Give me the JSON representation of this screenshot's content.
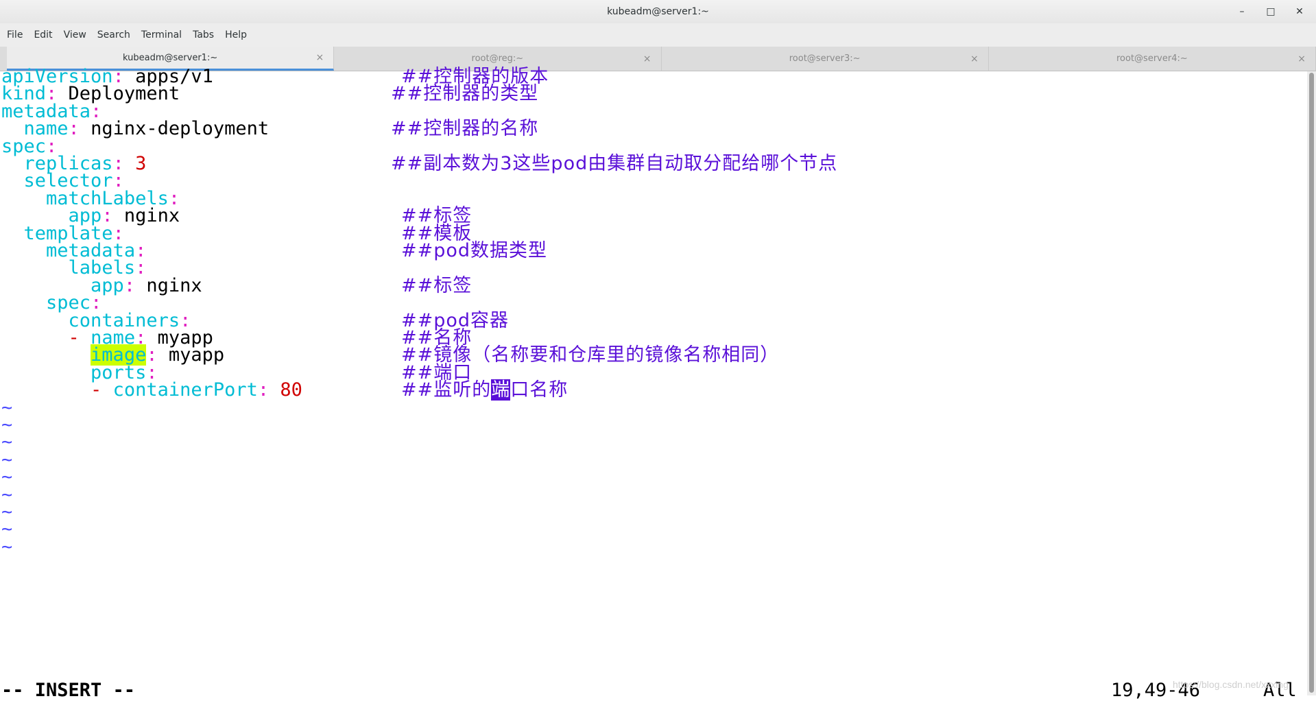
{
  "window": {
    "title": "kubeadm@server1:~",
    "minimize_icon": "minimize-icon",
    "maximize_icon": "maximize-icon",
    "close_icon": "close-icon"
  },
  "menu": [
    "File",
    "Edit",
    "View",
    "Search",
    "Terminal",
    "Tabs",
    "Help"
  ],
  "tabs": [
    {
      "label": "kubeadm@server1:~",
      "active": true
    },
    {
      "label": "root@reg:~",
      "active": false
    },
    {
      "label": "root@server3:~",
      "active": false
    },
    {
      "label": "root@server4:~",
      "active": false
    }
  ],
  "tab_close_glyph": "×",
  "editor": {
    "lines": [
      {
        "indent": "",
        "key": "apiVersion",
        "sep": ": ",
        "val": "apps/v1",
        "comment": "##控制器的版本"
      },
      {
        "indent": "",
        "key": "kind",
        "sep": ": ",
        "val": "Deployment",
        "comment": "##控制器的类型"
      },
      {
        "indent": "",
        "key": "metadata",
        "sep": ":",
        "val": "",
        "comment": ""
      },
      {
        "indent": "  ",
        "key": "name",
        "sep": ": ",
        "val": "nginx-deployment",
        "comment": "##控制器的名称"
      },
      {
        "indent": "",
        "key": "spec",
        "sep": ":",
        "val": "",
        "comment": ""
      },
      {
        "indent": "  ",
        "key": "replicas",
        "sep": ": ",
        "num": "3",
        "comment": "##副本数为3这些pod由集群自动取分配给哪个节点"
      },
      {
        "indent": "  ",
        "key": "selector",
        "sep": ":",
        "val": "",
        "comment": ""
      },
      {
        "indent": "    ",
        "key": "matchLabels",
        "sep": ":",
        "val": "",
        "comment": ""
      },
      {
        "indent": "      ",
        "key": "app",
        "sep": ": ",
        "val": "nginx",
        "comment": "##标签"
      },
      {
        "indent": "  ",
        "key": "template",
        "sep": ":",
        "val": "",
        "comment": "##模板"
      },
      {
        "indent": "    ",
        "key": "metadata",
        "sep": ":",
        "val": "",
        "comment": "##pod数据类型"
      },
      {
        "indent": "      ",
        "key": "labels",
        "sep": ":",
        "val": "",
        "comment": ""
      },
      {
        "indent": "        ",
        "key": "app",
        "sep": ": ",
        "val": "nginx",
        "comment": "##标签"
      },
      {
        "indent": "    ",
        "key": "spec",
        "sep": ":",
        "val": "",
        "comment": ""
      },
      {
        "indent": "      ",
        "key": "containers",
        "sep": ":",
        "val": "",
        "comment": "##pod容器"
      },
      {
        "indent": "      ",
        "dash": "- ",
        "key": "name",
        "sep": ": ",
        "val": "myapp",
        "comment": "##名称"
      },
      {
        "indent": "        ",
        "key": "image",
        "sep": ": ",
        "val": "myapp",
        "comment": "##镜像（名称要和仓库里的镜像名称相同）",
        "highlight_key": true
      },
      {
        "indent": "        ",
        "key": "ports",
        "sep": ":",
        "val": "",
        "comment": "##端口"
      },
      {
        "indent": "        ",
        "dash": "- ",
        "key": "containerPort",
        "sep": ": ",
        "num": "80",
        "comment_pre": "##监听的",
        "comment_cursor": "端",
        "comment_post": "口名称"
      }
    ],
    "tilde_count": 9,
    "tilde": "~"
  },
  "status": {
    "mode": "-- INSERT --",
    "position": "19,49-46",
    "scope": "All"
  },
  "watermark": "https://blog.csdn.net/xxxing",
  "colors": {
    "key": "#00bcd4",
    "colon": "#e020c0",
    "number": "#d00000",
    "comment": "#5a10d8",
    "tilde": "#4b4bff",
    "search_highlight": "#ccff00",
    "active_tab_underline": "#4a90d9"
  }
}
